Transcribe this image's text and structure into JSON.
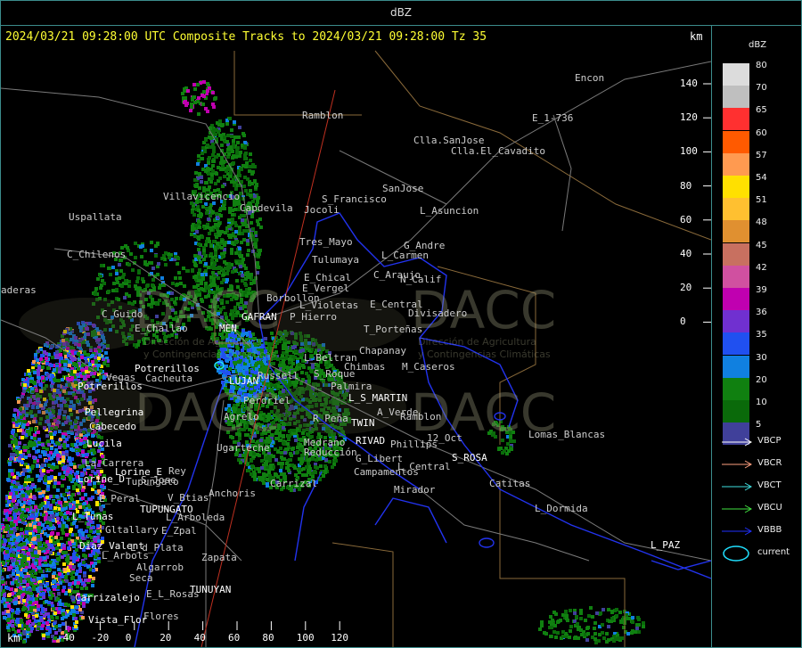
{
  "window": {
    "title": "dBZ"
  },
  "header": {
    "text": "2024/03/21 09:28:00 UTC Composite Tracks to 2024/03/21 09:28:00 Tz 35"
  },
  "axis": {
    "unit_top": "km",
    "unit_bottom": "km",
    "y_ticks": [
      "140",
      "120",
      "100",
      "80",
      "60",
      "40",
      "20",
      "0"
    ],
    "x_ticks": [
      "-40",
      "-20",
      "0",
      "20",
      "40",
      "60",
      "80",
      "100",
      "120"
    ]
  },
  "watermark": {
    "brand": "DACC",
    "line1": "Dirección de Agricultura",
    "line2": "y Contingencias Climáticas"
  },
  "cities": [
    "Ramblon",
    "Encon",
    "E_1-736",
    "Clla.SanJose",
    "Clla.El_Cavadito",
    "SanJose",
    "Villavicencio",
    "S_Francisco",
    "Jocoli",
    "L_Asuncion",
    "Uspallata",
    "Capdevila",
    "Tres_Mayo",
    "G_Andre",
    "Tulumaya",
    "L_Carmen",
    "C_Chilenos",
    "E_Chical",
    "C_Araujo",
    "E_Vergel",
    "N_Calif",
    "Borbollon",
    "E_Central",
    "Divisadero",
    "C_Guido",
    "L_Violetas",
    "P_Hierro",
    "MEN",
    "GAFRAN",
    "E_Challao",
    "T_Porteñas",
    "Chapanay",
    "L_Beltran",
    "Chimbas",
    "M_Caseros",
    "Potrerillos",
    "Vegas",
    "Cacheuta",
    "Palmira",
    "S_Roque",
    "LUJAN",
    "Russell",
    "L_S_MARTIN",
    "Potrerillos",
    "Pellegrina",
    "Perdriel",
    "Agrelo",
    "R_Peña",
    "TWIN",
    "A_Verde",
    "Ramblon",
    "Cabecedo",
    "Lucila",
    "Ugarteche",
    "Medrano",
    "RIVAD",
    "Phillips",
    "12_Oct",
    "Lomas_Blancas",
    "La_Carrera",
    "Lorine_E",
    "Tupungato",
    "Rey",
    "Reducción",
    "G_Libert",
    "L_Central",
    "S_ROSA",
    "Lorine_D",
    "S_Jose",
    "Campamentos",
    "Carrizal",
    "E_Peral",
    "V_Btias",
    "TUPUNGATO",
    "Anchoris",
    "Mirador",
    "Catitas",
    "L_Tunas",
    "L_Arboleda",
    "L_Dormida",
    "Gltallary",
    "E_Zpal",
    "Diaz_Valent",
    "L_d_Plata",
    "L_Arbols",
    "Zapata",
    "L_PAZ",
    "Algarrob",
    "Seca",
    "E_L_Rosas",
    "TUNUYAN",
    "Carrizalejo",
    "Vista_Flor",
    "Flores",
    "aderas"
  ],
  "legend": {
    "title": "dBZ",
    "scale": [
      {
        "label": "80",
        "color": "#dcdcdc"
      },
      {
        "label": "70",
        "color": "#bfbfbf"
      },
      {
        "label": "65",
        "color": "#ff3030"
      },
      {
        "label": "60",
        "color": "#ff5a00"
      },
      {
        "label": "57",
        "color": "#ff9a50"
      },
      {
        "label": "54",
        "color": "#ffe000"
      },
      {
        "label": "51",
        "color": "#ffc030"
      },
      {
        "label": "48",
        "color": "#e09030"
      },
      {
        "label": "45",
        "color": "#c87060"
      },
      {
        "label": "42",
        "color": "#d050a0"
      },
      {
        "label": "39",
        "color": "#c000b0"
      },
      {
        "label": "36",
        "color": "#7030d0"
      },
      {
        "label": "35",
        "color": "#2050f0"
      },
      {
        "label": "30",
        "color": "#1080e0"
      },
      {
        "label": "20",
        "color": "#108010"
      },
      {
        "label": "10",
        "color": "#0a6a0a"
      },
      {
        "label": "5",
        "color": "#40409a"
      }
    ],
    "tracks": [
      {
        "label": "VBCP",
        "color": "#ffffff"
      },
      {
        "label": "VBCR",
        "color": "#ffa080"
      },
      {
        "label": "VBCT",
        "color": "#40e0e0"
      },
      {
        "label": "VBCU",
        "color": "#40e040"
      },
      {
        "label": "VBBB",
        "color": "#2030ff"
      }
    ],
    "current": {
      "label": "current",
      "color": "#20e0ff"
    }
  }
}
